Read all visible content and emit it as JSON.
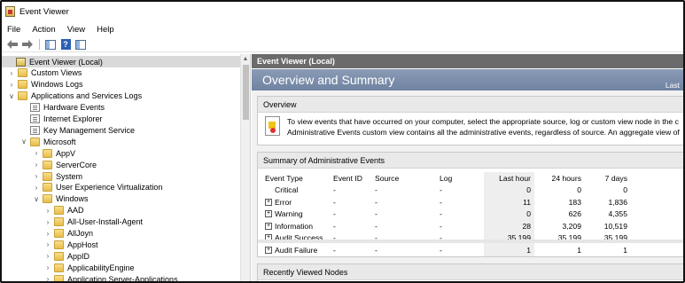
{
  "window": {
    "title": "Event Viewer"
  },
  "menu": [
    "File",
    "Action",
    "View",
    "Help"
  ],
  "toolbar": {
    "back_icon": "back-arrow-icon",
    "forward_icon": "forward-arrow-icon",
    "help_glyph": "?"
  },
  "tree": [
    {
      "label": "Event Viewer (Local)",
      "level": 0,
      "expander": "none",
      "icon": "root",
      "selected": true
    },
    {
      "label": "Custom Views",
      "level": 1,
      "expander": ">",
      "icon": "folder"
    },
    {
      "label": "Windows Logs",
      "level": 1,
      "expander": ">",
      "icon": "folder"
    },
    {
      "label": "Applications and Services Logs",
      "level": 1,
      "expander": "v",
      "icon": "folder"
    },
    {
      "label": "Hardware Events",
      "level": 2,
      "expander": "none",
      "icon": "log"
    },
    {
      "label": "Internet Explorer",
      "level": 2,
      "expander": "none",
      "icon": "log"
    },
    {
      "label": "Key Management Service",
      "level": 2,
      "expander": "none",
      "icon": "log"
    },
    {
      "label": "Microsoft",
      "level": 2,
      "expander": "v",
      "icon": "folder"
    },
    {
      "label": "AppV",
      "level": 3,
      "expander": ">",
      "icon": "folder"
    },
    {
      "label": "ServerCore",
      "level": 3,
      "expander": ">",
      "icon": "folder"
    },
    {
      "label": "System",
      "level": 3,
      "expander": ">",
      "icon": "folder"
    },
    {
      "label": "User Experience Virtualization",
      "level": 3,
      "expander": ">",
      "icon": "folder"
    },
    {
      "label": "Windows",
      "level": 3,
      "expander": "v",
      "icon": "folder"
    },
    {
      "label": "AAD",
      "level": 4,
      "expander": ">",
      "icon": "folder"
    },
    {
      "label": "All-User-Install-Agent",
      "level": 4,
      "expander": ">",
      "icon": "folder"
    },
    {
      "label": "AllJoyn",
      "level": 4,
      "expander": ">",
      "icon": "folder"
    },
    {
      "label": "AppHost",
      "level": 4,
      "expander": ">",
      "icon": "folder"
    },
    {
      "label": "AppID",
      "level": 4,
      "expander": ">",
      "icon": "folder"
    },
    {
      "label": "ApplicabilityEngine",
      "level": 4,
      "expander": ">",
      "icon": "folder"
    },
    {
      "label": "Application Server-Applications",
      "level": 4,
      "expander": ">",
      "icon": "folder"
    }
  ],
  "right": {
    "header": "Event Viewer (Local)",
    "banner_title": "Overview and Summary",
    "banner_right": "Last",
    "overview": {
      "title": "Overview",
      "line1": "To view events that have occurred on your computer, select the appropriate source, log or custom view node in the c",
      "line2": "Administrative Events custom view contains all the administrative events, regardless of source. An aggregate view of"
    },
    "summary": {
      "title": "Summary of Administrative Events",
      "columns": [
        "Event Type",
        "Event ID",
        "Source",
        "Log",
        "Last hour",
        "24 hours",
        "7 days"
      ],
      "rows": [
        {
          "expandable": false,
          "type": "Critical",
          "id": "-",
          "source": "-",
          "log": "-",
          "hour": "0",
          "day": "0",
          "week": "0"
        },
        {
          "expandable": true,
          "type": "Error",
          "id": "-",
          "source": "-",
          "log": "-",
          "hour": "11",
          "day": "183",
          "week": "1,836"
        },
        {
          "expandable": true,
          "type": "Warning",
          "id": "-",
          "source": "-",
          "log": "-",
          "hour": "0",
          "day": "626",
          "week": "4,355"
        },
        {
          "expandable": true,
          "type": "Information",
          "id": "-",
          "source": "-",
          "log": "-",
          "hour": "28",
          "day": "3,209",
          "week": "10,519"
        },
        {
          "expandable": true,
          "type": "Audit Success",
          "id": "-",
          "source": "-",
          "log": "-",
          "hour": "35,199",
          "day": "35,199",
          "week": "35,199"
        },
        {
          "expandable": true,
          "type": "Audit Failure",
          "id": "-",
          "source": "-",
          "log": "-",
          "hour": "1",
          "day": "1",
          "week": "1"
        }
      ]
    },
    "recent": {
      "title": "Recently Viewed Nodes"
    }
  }
}
